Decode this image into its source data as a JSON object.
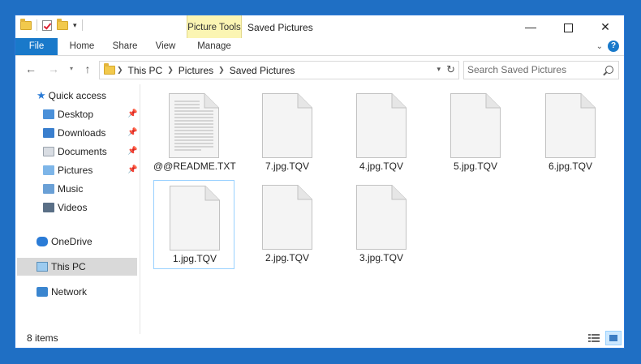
{
  "window": {
    "title": "Saved Pictures",
    "context_tab_group": "Picture Tools",
    "controls": {
      "minimize": "—",
      "close": "✕"
    }
  },
  "ribbon": {
    "tabs": [
      {
        "label": "File",
        "active": true
      },
      {
        "label": "Home"
      },
      {
        "label": "Share"
      },
      {
        "label": "View"
      },
      {
        "label": "Manage"
      }
    ],
    "help": "?"
  },
  "address": {
    "crumbs": [
      "This PC",
      "Pictures",
      "Saved Pictures"
    ]
  },
  "search": {
    "placeholder": "Search Saved Pictures"
  },
  "nav": {
    "quick_access": "Quick access",
    "items": [
      {
        "label": "Desktop",
        "pinned": true
      },
      {
        "label": "Downloads",
        "pinned": true
      },
      {
        "label": "Documents",
        "pinned": true
      },
      {
        "label": "Pictures",
        "pinned": true
      },
      {
        "label": "Music"
      },
      {
        "label": "Videos"
      }
    ],
    "onedrive": "OneDrive",
    "this_pc": "This PC",
    "network": "Network"
  },
  "files": [
    {
      "name": "@@README.TXT",
      "type": "txt"
    },
    {
      "name": "7.jpg.TQV",
      "type": "blank"
    },
    {
      "name": "4.jpg.TQV",
      "type": "blank"
    },
    {
      "name": "5.jpg.TQV",
      "type": "blank"
    },
    {
      "name": "6.jpg.TQV",
      "type": "blank"
    },
    {
      "name": "1.jpg.TQV",
      "type": "blank",
      "focused": true
    },
    {
      "name": "2.jpg.TQV",
      "type": "blank"
    },
    {
      "name": "3.jpg.TQV",
      "type": "blank"
    }
  ],
  "status": {
    "item_count": "8 items"
  },
  "colors": {
    "accent": "#1979ca",
    "context_tab": "#fbf5b3",
    "desktop_bg": "#1f6fc4"
  }
}
